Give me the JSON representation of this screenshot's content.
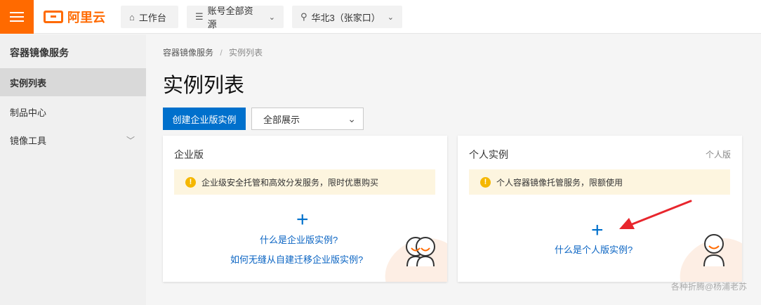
{
  "topbar": {
    "brand": "阿里云",
    "workbench": "工作台",
    "resources": "账号全部资源",
    "region": "华北3（张家口）"
  },
  "sidebar": {
    "title": "容器镜像服务",
    "items": [
      {
        "label": "实例列表"
      },
      {
        "label": "制品中心"
      },
      {
        "label": "镜像工具"
      }
    ]
  },
  "breadcrumb": {
    "root": "容器镜像服务",
    "separator": "/",
    "current": "实例列表"
  },
  "page": {
    "title": "实例列表",
    "create_button": "创建企业版实例",
    "filter_value": "全部展示"
  },
  "cards": {
    "enterprise": {
      "title": "企业版",
      "notice": "企业级安全托管和高效分发服务，限时优惠购买",
      "link1": "什么是企业版实例?",
      "link2": "如何无缝从自建迁移企业版实例?"
    },
    "personal": {
      "title": "个人实例",
      "tag": "个人版",
      "notice": "个人容器镜像托管服务，限额使用",
      "link1": "什么是个人版实例?"
    }
  },
  "watermark": "各种折腾@杨浦老苏",
  "colors": {
    "brand": "#ff6a00",
    "primary": "#0070cc",
    "notice_bg": "#fdf5df",
    "annotation_arrow": "#e8262d"
  }
}
